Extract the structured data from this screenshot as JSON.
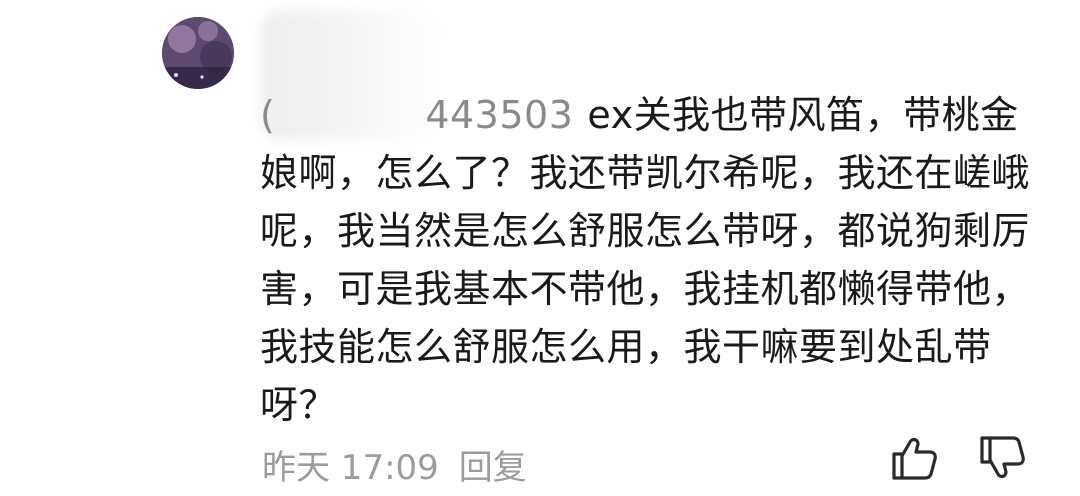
{
  "comment": {
    "mention_visible": "443503",
    "text": "ex关我也带风笛，带桃金娘啊，怎么了？我还带凯尔希呢，我还在嵯峨呢，我当然是怎么舒服怎么带呀，都说狗剩厉害，可是我基本不带他，我挂机都懒得带他，我技能怎么舒服怎么用，我干嘛要到处乱带呀？",
    "timestamp": "昨天 17:09",
    "reply_label": "回复"
  },
  "icons": {
    "avatar": "user-avatar",
    "like": "thumbs-up-icon",
    "dislike": "thumbs-down-icon"
  },
  "colors": {
    "text": "#1a1a1a",
    "meta": "#9c9c9c",
    "icon": "#2a2a2a"
  }
}
